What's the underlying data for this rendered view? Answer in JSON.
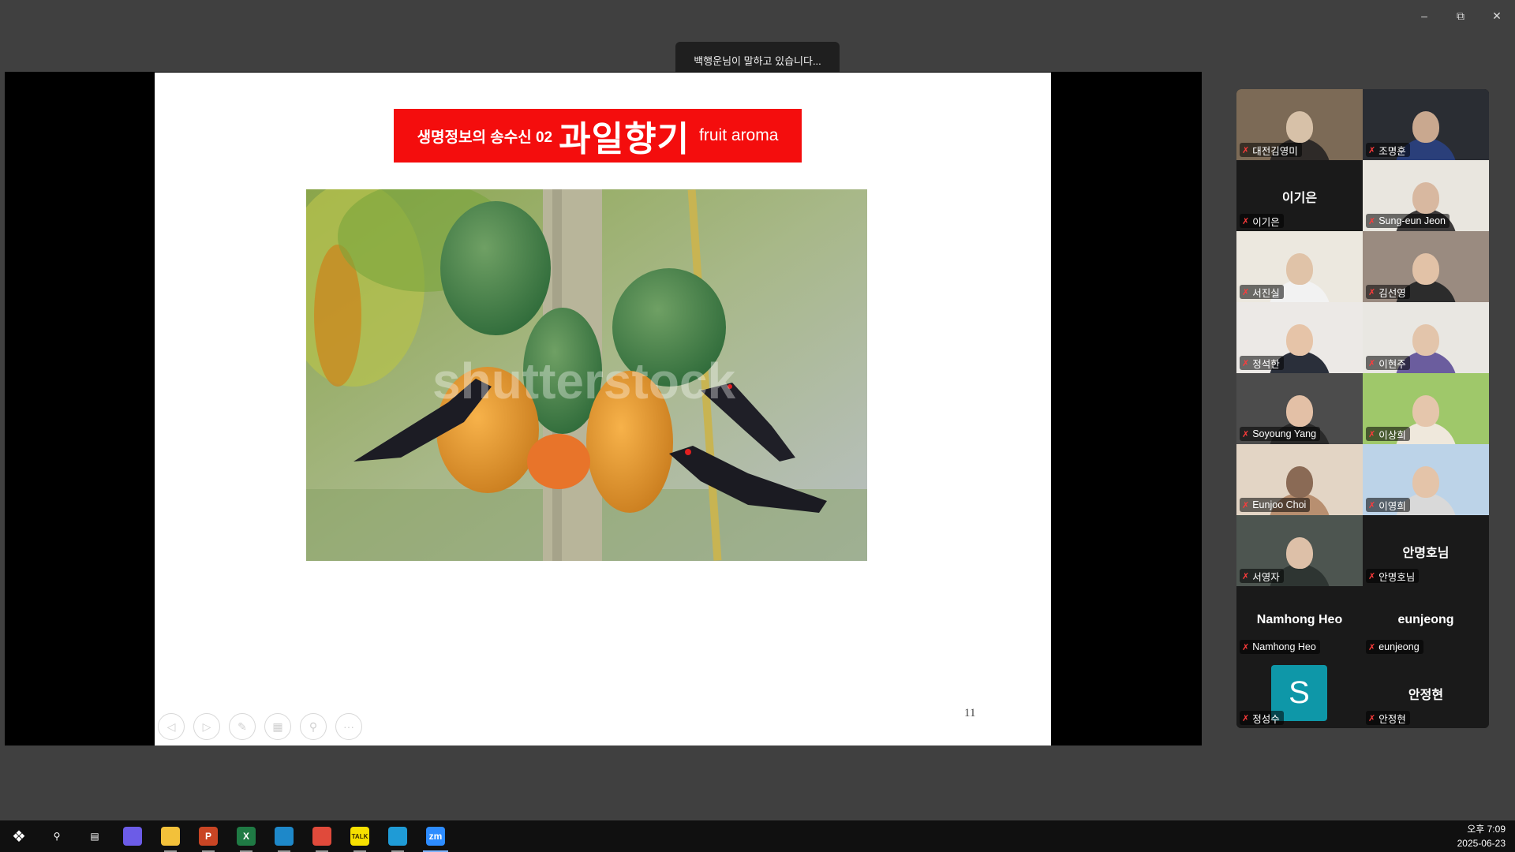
{
  "window": {
    "minimize_icon": "minimize-icon",
    "restore_icon": "restore-icon",
    "close_icon": "close-icon"
  },
  "speaking_toast": "백행운님이 말하고 있습니다...",
  "slide": {
    "title_prefix": "생명정보의 송수신 02",
    "title_main": "과일향기",
    "title_en": "fruit aroma",
    "title_bg": "#f40d0d",
    "watermark": "shutterstock",
    "page_number": "11",
    "tools": [
      "prev-slide-icon",
      "next-slide-icon",
      "pen-icon",
      "slides-grid-icon",
      "zoom-icon",
      "more-icon"
    ]
  },
  "participants": [
    {
      "name": "대전김영미",
      "type": "video"
    },
    {
      "name": "조명훈",
      "type": "video"
    },
    {
      "name": "이기은",
      "type": "name",
      "display": "이기은"
    },
    {
      "name": "Sung-eun Jeon",
      "type": "video"
    },
    {
      "name": "서진실",
      "type": "video"
    },
    {
      "name": "김선영",
      "type": "video"
    },
    {
      "name": "정석한",
      "type": "video"
    },
    {
      "name": "이현주",
      "type": "video"
    },
    {
      "name": "Soyoung Yang",
      "type": "video"
    },
    {
      "name": "이상희",
      "type": "video"
    },
    {
      "name": "Eunjoo Choi",
      "type": "video"
    },
    {
      "name": "이영희",
      "type": "video"
    },
    {
      "name": "서영자",
      "type": "video"
    },
    {
      "name": "안명호님",
      "type": "name",
      "display": "안명호님"
    },
    {
      "name": "Namhong Heo",
      "type": "name",
      "display": "Namhong Heo"
    },
    {
      "name": "eunjeong",
      "type": "name",
      "display": "eunjeong"
    },
    {
      "name": "정성수",
      "type": "avatar",
      "display": "S"
    },
    {
      "name": "안정현",
      "type": "name",
      "display": "안정현"
    }
  ],
  "taskbar": {
    "apps": [
      {
        "name": "start-icon",
        "label": ""
      },
      {
        "name": "search-icon",
        "label": ""
      },
      {
        "name": "task-view-icon",
        "label": ""
      },
      {
        "name": "copilot-icon",
        "label": ""
      },
      {
        "name": "file-explorer-icon",
        "label": ""
      },
      {
        "name": "powerpoint-icon",
        "label": "P"
      },
      {
        "name": "excel-icon",
        "label": "X"
      },
      {
        "name": "app-blue-icon",
        "label": ""
      },
      {
        "name": "chrome-icon",
        "label": ""
      },
      {
        "name": "kakaotalk-icon",
        "label": "TALK"
      },
      {
        "name": "edge-icon",
        "label": ""
      },
      {
        "name": "zoom-icon",
        "label": "zm"
      }
    ],
    "time": "오후 7:09",
    "date": "2025-06-23"
  }
}
